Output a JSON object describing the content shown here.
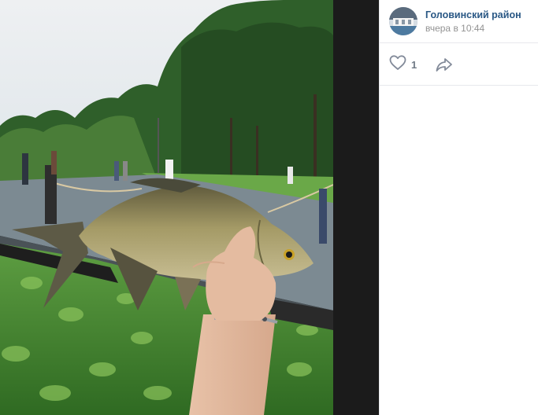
{
  "post": {
    "author": "Головинский район",
    "date": "вчера в 10:44",
    "likes": "1"
  },
  "icons": {
    "like": "heart-outline-icon",
    "share": "share-arrow-icon"
  },
  "colors": {
    "author_link": "#2a5885",
    "secondary_text": "#939393",
    "icon": "#828a99",
    "divider": "#e7e8ec"
  }
}
